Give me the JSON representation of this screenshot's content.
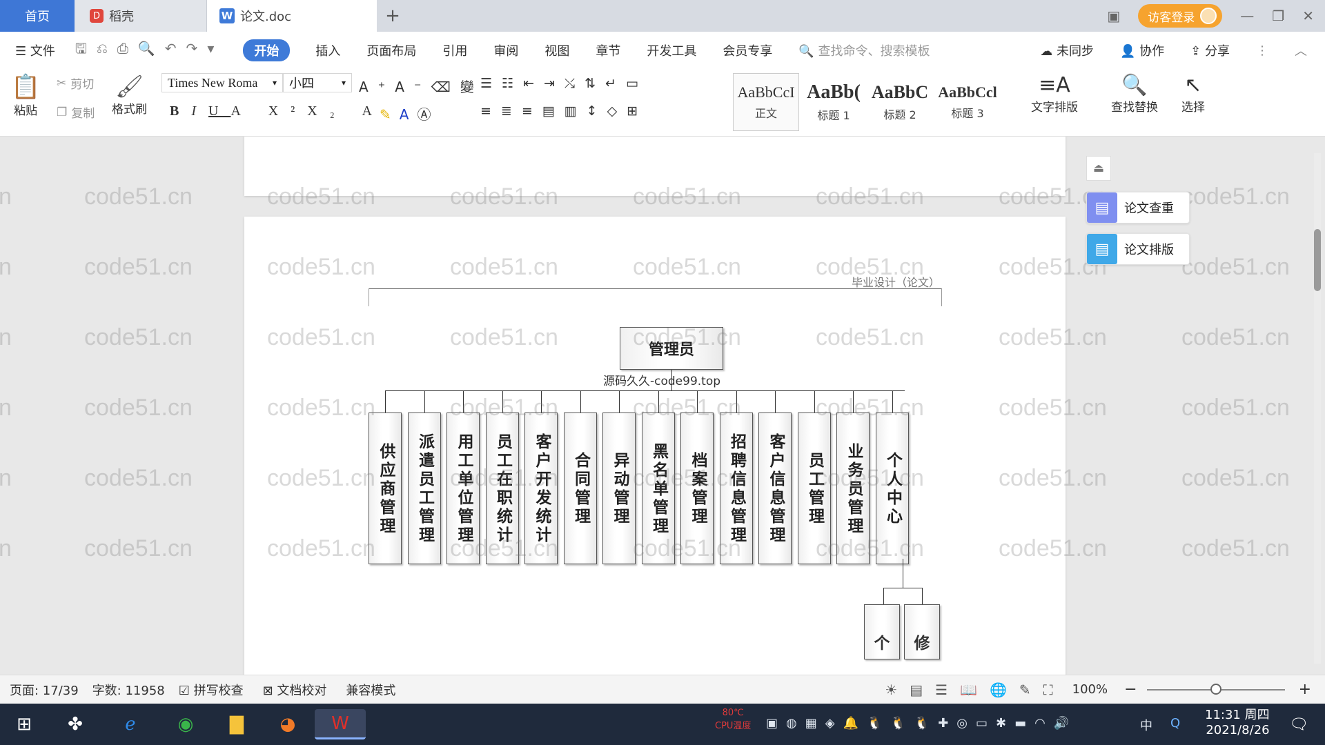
{
  "tabs": {
    "home": "首页",
    "daoke": "稻壳",
    "doc": "论文.doc",
    "add": "+"
  },
  "titlebar": {
    "login": "访客登录"
  },
  "menu": {
    "file": "文件",
    "items": [
      "开始",
      "插入",
      "页面布局",
      "引用",
      "审阅",
      "视图",
      "章节",
      "开发工具",
      "会员专享"
    ],
    "search_placeholder": "查找命令、搜索模板",
    "sync": "未同步",
    "collab": "协作",
    "share": "分享"
  },
  "ribbon": {
    "paste": "粘贴",
    "cut": "剪切",
    "copy": "复制",
    "format_painter": "格式刷",
    "font_name": "Times New Roma",
    "font_size": "小四",
    "styles": [
      {
        "preview": "AaBbCcI",
        "name": "正文"
      },
      {
        "preview": "AaBb(",
        "name": "标题 1"
      },
      {
        "preview": "AaBbC",
        "name": "标题 2"
      },
      {
        "preview": "AaBbCcl",
        "name": "标题 3"
      }
    ],
    "text_layout": "文字排版",
    "find_replace": "查找替换",
    "select": "选择"
  },
  "document": {
    "header": "毕业设计（论文）",
    "root": "管理员",
    "caption": "源码久久-code99.top",
    "modules": [
      "供应商管理",
      "派遣员工管理",
      "用工单位管理",
      "员工在职统计",
      "客户开发统计",
      "合同管理",
      "异动管理",
      "黑名单管理",
      "档案管理",
      "招聘信息管理",
      "客户信息管理",
      "员工管理",
      "业务员管理",
      "个人中心"
    ],
    "sub_modules": [
      "个",
      "修"
    ]
  },
  "watermark": "code51.cn",
  "side_panel": {
    "check": "论文查重",
    "layout": "论文排版"
  },
  "statusbar": {
    "page": "页面: 17/39",
    "words": "字数: 11958",
    "spell": "拼写校查",
    "proof": "文档校对",
    "compat": "兼容模式",
    "zoom": "100%",
    "zoom_level": 0.5
  },
  "taskbar": {
    "cpu": "80℃",
    "cpu_label": "CPU温度",
    "time": "11:31 周四",
    "date": "2021/8/26",
    "ime": "中"
  }
}
